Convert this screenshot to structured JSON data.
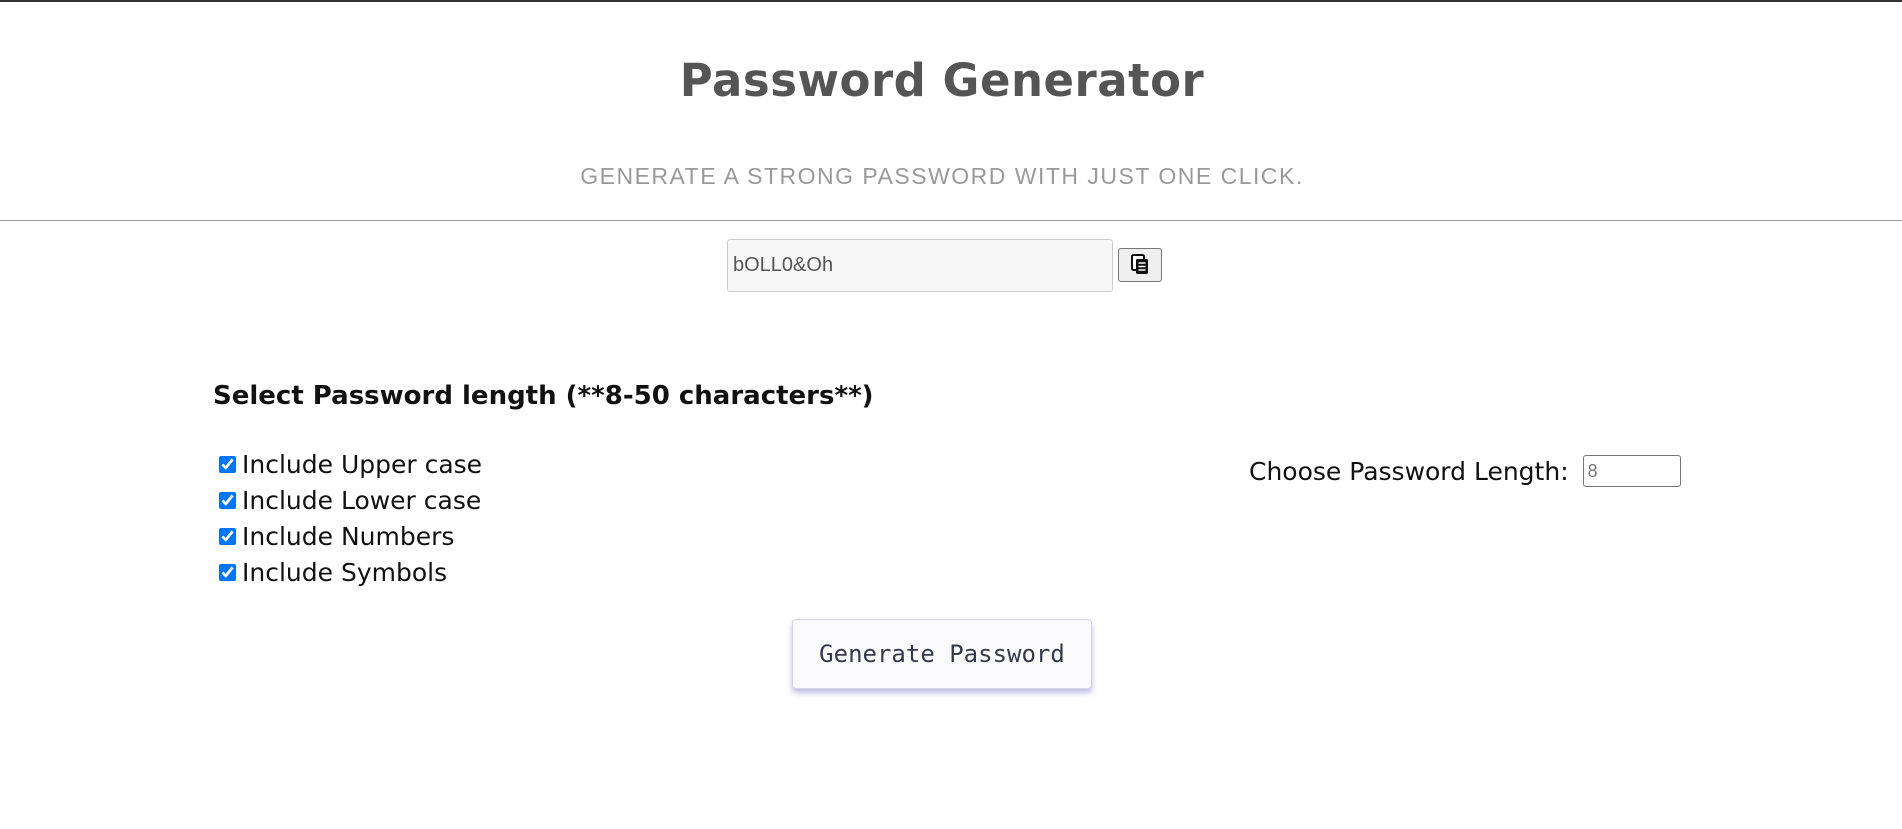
{
  "header": {
    "title": "Password Generator",
    "subtitle": "GENERATE A STRONG PASSWORD WITH JUST ONE CLICK."
  },
  "password": {
    "value": "bOLL0&Oh",
    "copy_icon": "copy-icon"
  },
  "length_section": {
    "heading": "Select Password length (**8-50 characters**)",
    "choose_label": "Choose Password Length:",
    "length_value": "8"
  },
  "options": [
    {
      "label": "Include Upper case",
      "checked": true
    },
    {
      "label": "Include Lower case",
      "checked": true
    },
    {
      "label": "Include Numbers",
      "checked": true
    },
    {
      "label": "Include Symbols",
      "checked": true
    }
  ],
  "actions": {
    "generate_label": "Generate Password"
  },
  "colors": {
    "title": "#555555",
    "subtitle": "#999999",
    "checkbox_accent": "#0075ff",
    "button_shadow": "#786ebe"
  }
}
